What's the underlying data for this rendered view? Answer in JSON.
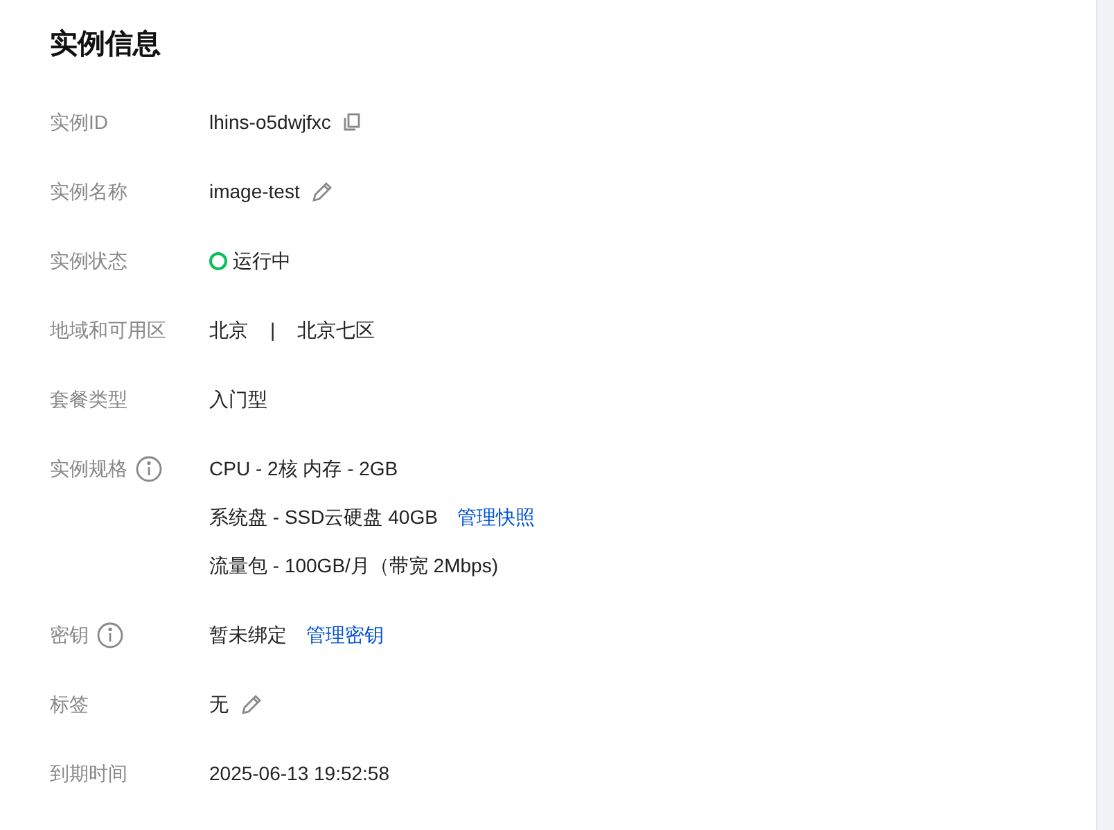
{
  "title": "实例信息",
  "fields": [
    {
      "label": "实例ID",
      "info": false,
      "lines": [
        [
          {
            "kind": "text",
            "text": "lhins-o5dwjfxc"
          },
          {
            "kind": "copy"
          }
        ]
      ]
    },
    {
      "label": "实例名称",
      "info": false,
      "lines": [
        [
          {
            "kind": "text",
            "text": "image-test"
          },
          {
            "kind": "edit"
          }
        ]
      ]
    },
    {
      "label": "实例状态",
      "info": false,
      "lines": [
        [
          {
            "kind": "status",
            "text": "运行中"
          }
        ]
      ]
    },
    {
      "label": "地域和可用区",
      "info": false,
      "lines": [
        [
          {
            "kind": "text",
            "text": "北京"
          },
          {
            "kind": "sep",
            "text": "|"
          },
          {
            "kind": "text",
            "text": "北京七区"
          }
        ]
      ]
    },
    {
      "label": "套餐类型",
      "info": false,
      "lines": [
        [
          {
            "kind": "text",
            "text": "入门型"
          }
        ]
      ]
    },
    {
      "label": "实例规格",
      "info": true,
      "lines": [
        [
          {
            "kind": "text",
            "text": "CPU - 2核 内存 - 2GB"
          }
        ],
        [
          {
            "kind": "text",
            "text": "系统盘 - SSD云硬盘 40GB"
          },
          {
            "kind": "link",
            "text": "管理快照"
          }
        ],
        [
          {
            "kind": "text",
            "text": "流量包 - 100GB/月（带宽 2Mbps)"
          }
        ]
      ]
    },
    {
      "label": "密钥",
      "info": true,
      "lines": [
        [
          {
            "kind": "text",
            "text": "暂未绑定"
          },
          {
            "kind": "link",
            "text": "管理密钥"
          }
        ]
      ]
    },
    {
      "label": "标签",
      "info": false,
      "lines": [
        [
          {
            "kind": "text",
            "text": "无"
          },
          {
            "kind": "edit"
          }
        ]
      ]
    },
    {
      "label": "到期时间",
      "info": false,
      "lines": [
        [
          {
            "kind": "text",
            "text": "2025-06-13 19:52:58"
          }
        ]
      ]
    }
  ]
}
